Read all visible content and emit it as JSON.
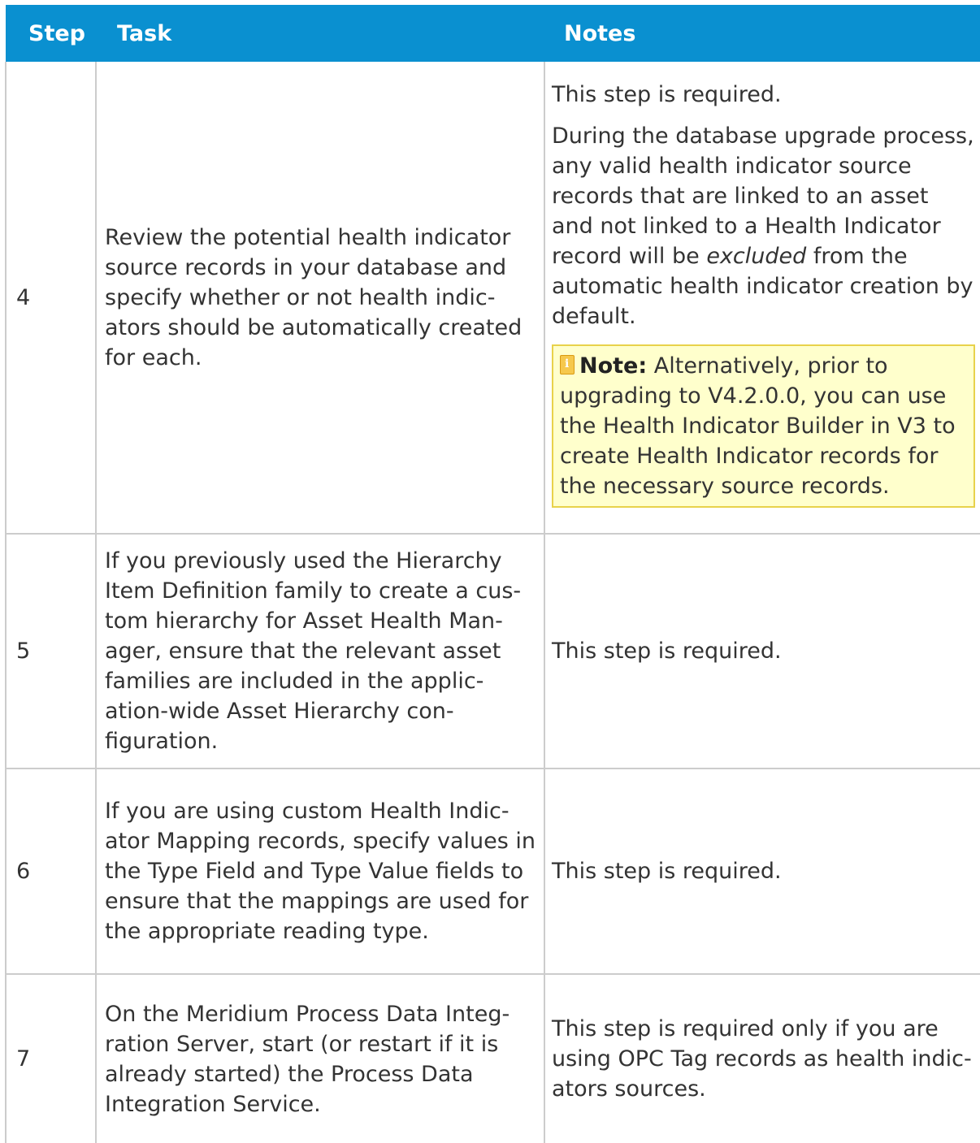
{
  "table": {
    "headers": {
      "step": "Step",
      "task": "Task",
      "notes": "Notes"
    },
    "rows": [
      {
        "step": "4",
        "task": "Review the potential health indicator source records in your database and specify whether or not health indic-ators should be automatically created for each.",
        "notes": {
          "p1": "This step is required.",
          "p2_before": "During the database upgrade process, any valid health indicator source records that are linked to an asset and not linked to a Health Indicator record will be ",
          "p2_emphasis": "excluded",
          "p2_after": " from the automatic health indicator creation by default.",
          "note_icon": "note-icon",
          "note_label": "Note:",
          "note_text": " Alternatively, prior to upgrading to V4.2.0.0, you can use the Health Indicator Builder in V3 to create Health Indicator records for the necessary source records."
        }
      },
      {
        "step": "5",
        "task": "If you previously used the Hierarchy Item Definition family to create a cus-tom hierarchy for Asset Health Man-ager, ensure that the relevant asset families are included in the applic-ation-wide Asset Hierarchy con-figuration.",
        "notes": "This step is required."
      },
      {
        "step": "6",
        "task": "If you are using custom Health Indic-ator Mapping records, specify values in the Type Field and Type Value fields to ensure that the mappings are used for the appropriate reading type.",
        "notes": "This step is required."
      },
      {
        "step": "7",
        "task": "On the Meridium Process Data Integ-ration Server, start (or restart if it is already started) the Process Data Integration Service.",
        "notes": "This step is required only if you are using OPC Tag records as health indic-ators sources."
      }
    ]
  },
  "colors": {
    "header_background": "#0a90d0",
    "note_background": "#ffffcc",
    "note_border": "#e8d24b"
  }
}
